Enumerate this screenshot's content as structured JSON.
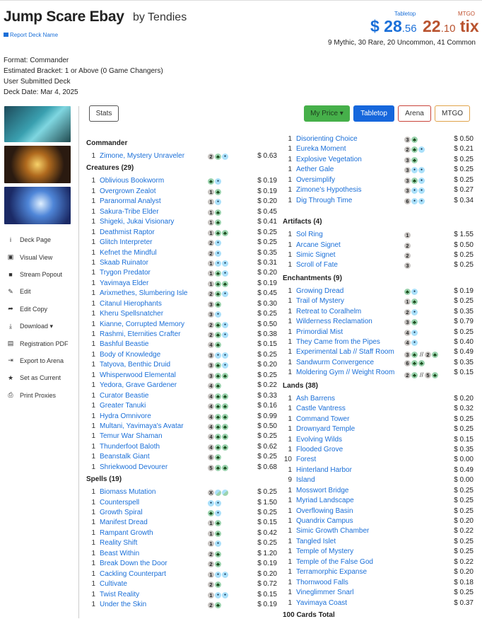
{
  "header": {
    "title": "Jump Scare Ebay",
    "author": "by Tendies",
    "report": "Report Deck Name",
    "tabletop_label": "Tabletop",
    "tabletop_price": "$ 28",
    "tabletop_cents": ".56",
    "mtgo_label": "MTGO",
    "mtgo_price": "22",
    "mtgo_cents": ".10",
    "mtgo_unit": " tix",
    "rarity": "9 Mythic, 30 Rare, 20 Uncommon, 41 Common"
  },
  "meta": {
    "format": "Format: Commander",
    "bracket": "Estimated Bracket: 1 or Above (0 Game Changers)",
    "source": "User Submitted Deck",
    "date": "Deck Date: Mar 4, 2025"
  },
  "sidebar": [
    {
      "icon": "info-icon",
      "glyph": "i",
      "label": "Deck Page"
    },
    {
      "icon": "image-icon",
      "glyph": "▣",
      "label": "Visual View"
    },
    {
      "icon": "video-icon",
      "glyph": "■",
      "label": "Stream Popout"
    },
    {
      "icon": "edit-icon",
      "glyph": "✎",
      "label": "Edit"
    },
    {
      "icon": "share-icon",
      "glyph": "➦",
      "label": "Edit Copy"
    },
    {
      "icon": "download-icon",
      "glyph": "⤓",
      "label": "Download ▾"
    },
    {
      "icon": "pdf-icon",
      "glyph": "▤",
      "label": "Registration PDF"
    },
    {
      "icon": "export-icon",
      "glyph": "⇥",
      "label": "Export to Arena"
    },
    {
      "icon": "star-icon",
      "glyph": "★",
      "label": "Set as Current"
    },
    {
      "icon": "print-icon",
      "glyph": "⎙",
      "label": "Print Proxies"
    }
  ],
  "toolbar": {
    "stats": "Stats",
    "my_price": "My Price ▾",
    "tabletop": "Tabletop",
    "arena": "Arena",
    "mtgo": "MTGO"
  },
  "colors": {
    "link": "#1a6fd8",
    "green": "#46b04a",
    "blue": "#1667dc",
    "mtgo": "#b9532f"
  },
  "columns": [
    [
      {
        "title": "Commander",
        "cards": [
          {
            "q": "1",
            "n": "Zimone, Mystery Unraveler",
            "m": [
              "2",
              "G",
              "U"
            ],
            "p": "$ 0.63"
          }
        ]
      },
      {
        "title": "Creatures (29)",
        "cards": [
          {
            "q": "1",
            "n": "Oblivious Bookworm",
            "m": [
              "G",
              "U"
            ],
            "p": "$ 0.19"
          },
          {
            "q": "1",
            "n": "Overgrown Zealot",
            "m": [
              "1",
              "G"
            ],
            "p": "$ 0.19"
          },
          {
            "q": "1",
            "n": "Paranormal Analyst",
            "m": [
              "1",
              "U"
            ],
            "p": "$ 0.20"
          },
          {
            "q": "1",
            "n": "Sakura-Tribe Elder",
            "m": [
              "1",
              "G"
            ],
            "p": "$ 0.45"
          },
          {
            "q": "1",
            "n": "Shigeki, Jukai Visionary",
            "m": [
              "1",
              "G"
            ],
            "p": "$ 0.41"
          },
          {
            "q": "1",
            "n": "Deathmist Raptor",
            "m": [
              "1",
              "G",
              "G"
            ],
            "p": "$ 0.25"
          },
          {
            "q": "1",
            "n": "Glitch Interpreter",
            "m": [
              "2",
              "U"
            ],
            "p": "$ 0.25"
          },
          {
            "q": "1",
            "n": "Kefnet the Mindful",
            "m": [
              "2",
              "U"
            ],
            "p": "$ 0.35"
          },
          {
            "q": "1",
            "n": "Skaab Ruinator",
            "m": [
              "1",
              "U",
              "U"
            ],
            "p": "$ 0.31"
          },
          {
            "q": "1",
            "n": "Trygon Predator",
            "m": [
              "1",
              "G",
              "U"
            ],
            "p": "$ 0.20"
          },
          {
            "q": "1",
            "n": "Yavimaya Elder",
            "m": [
              "1",
              "G",
              "G"
            ],
            "p": "$ 0.19"
          },
          {
            "q": "1",
            "n": "Arixmethes, Slumbering Isle",
            "m": [
              "2",
              "G",
              "U"
            ],
            "p": "$ 0.45"
          },
          {
            "q": "1",
            "n": "Citanul Hierophants",
            "m": [
              "3",
              "G"
            ],
            "p": "$ 0.30"
          },
          {
            "q": "1",
            "n": "Kheru Spellsnatcher",
            "m": [
              "3",
              "U"
            ],
            "p": "$ 0.25"
          },
          {
            "q": "1",
            "n": "Kianne, Corrupted Memory",
            "m": [
              "2",
              "G",
              "U"
            ],
            "p": "$ 0.50"
          },
          {
            "q": "1",
            "n": "Rashmi, Eternities Crafter",
            "m": [
              "2",
              "G",
              "U"
            ],
            "p": "$ 0.38"
          },
          {
            "q": "1",
            "n": "Bashful Beastie",
            "m": [
              "4",
              "G"
            ],
            "p": "$ 0.15"
          },
          {
            "q": "1",
            "n": "Body of Knowledge",
            "m": [
              "3",
              "U",
              "U"
            ],
            "p": "$ 0.25"
          },
          {
            "q": "1",
            "n": "Tatyova, Benthic Druid",
            "m": [
              "3",
              "G",
              "U"
            ],
            "p": "$ 0.20"
          },
          {
            "q": "1",
            "n": "Whisperwood Elemental",
            "m": [
              "3",
              "G",
              "G"
            ],
            "p": "$ 0.25"
          },
          {
            "q": "1",
            "n": "Yedora, Grave Gardener",
            "m": [
              "4",
              "G"
            ],
            "p": "$ 0.22"
          },
          {
            "q": "1",
            "n": "Curator Beastie",
            "m": [
              "4",
              "G",
              "G"
            ],
            "p": "$ 0.33"
          },
          {
            "q": "1",
            "n": "Greater Tanuki",
            "m": [
              "4",
              "G",
              "G"
            ],
            "p": "$ 0.16"
          },
          {
            "q": "1",
            "n": "Hydra Omnivore",
            "m": [
              "4",
              "G",
              "G"
            ],
            "p": "$ 0.99"
          },
          {
            "q": "1",
            "n": "Multani, Yavimaya's Avatar",
            "m": [
              "4",
              "G",
              "G"
            ],
            "p": "$ 0.50"
          },
          {
            "q": "1",
            "n": "Temur War Shaman",
            "m": [
              "4",
              "G",
              "G"
            ],
            "p": "$ 0.25"
          },
          {
            "q": "1",
            "n": "Thunderfoot Baloth",
            "m": [
              "4",
              "G",
              "G"
            ],
            "p": "$ 0.62"
          },
          {
            "q": "1",
            "n": "Beanstalk Giant",
            "m": [
              "6",
              "G"
            ],
            "p": "$ 0.25"
          },
          {
            "q": "1",
            "n": "Shriekwood Devourer",
            "m": [
              "5",
              "G",
              "G"
            ],
            "p": "$ 0.68"
          }
        ]
      },
      {
        "title": "Spells (19)",
        "cards": [
          {
            "q": "1",
            "n": "Biomass Mutation",
            "m": [
              "X",
              "H",
              "H"
            ],
            "p": "$ 0.25"
          },
          {
            "q": "1",
            "n": "Counterspell",
            "m": [
              "U",
              "U"
            ],
            "p": "$ 1.50"
          },
          {
            "q": "1",
            "n": "Growth Spiral",
            "m": [
              "G",
              "U"
            ],
            "p": "$ 0.25"
          },
          {
            "q": "1",
            "n": "Manifest Dread",
            "m": [
              "1",
              "G"
            ],
            "p": "$ 0.15"
          },
          {
            "q": "1",
            "n": "Rampant Growth",
            "m": [
              "1",
              "G"
            ],
            "p": "$ 0.42"
          },
          {
            "q": "1",
            "n": "Reality Shift",
            "m": [
              "1",
              "U"
            ],
            "p": "$ 0.25"
          },
          {
            "q": "1",
            "n": "Beast Within",
            "m": [
              "2",
              "G"
            ],
            "p": "$ 1.20"
          },
          {
            "q": "1",
            "n": "Break Down the Door",
            "m": [
              "2",
              "G"
            ],
            "p": "$ 0.19"
          },
          {
            "q": "1",
            "n": "Cackling Counterpart",
            "m": [
              "1",
              "U",
              "U"
            ],
            "p": "$ 0.20"
          },
          {
            "q": "1",
            "n": "Cultivate",
            "m": [
              "2",
              "G"
            ],
            "p": "$ 0.72"
          },
          {
            "q": "1",
            "n": "Twist Reality",
            "m": [
              "1",
              "U",
              "U"
            ],
            "p": "$ 0.15"
          },
          {
            "q": "1",
            "n": "Under the Skin",
            "m": [
              "2",
              "G"
            ],
            "p": "$ 0.19"
          }
        ]
      }
    ],
    [
      {
        "title": "",
        "cards": [
          {
            "q": "1",
            "n": "Disorienting Choice",
            "m": [
              "3",
              "G"
            ],
            "p": "$ 0.50"
          },
          {
            "q": "1",
            "n": "Eureka Moment",
            "m": [
              "2",
              "G",
              "U"
            ],
            "p": "$ 0.21"
          },
          {
            "q": "1",
            "n": "Explosive Vegetation",
            "m": [
              "3",
              "G"
            ],
            "p": "$ 0.25"
          },
          {
            "q": "1",
            "n": "Aether Gale",
            "m": [
              "3",
              "U",
              "U"
            ],
            "p": "$ 0.25"
          },
          {
            "q": "1",
            "n": "Oversimplify",
            "m": [
              "3",
              "G",
              "U"
            ],
            "p": "$ 0.25"
          },
          {
            "q": "1",
            "n": "Zimone's Hypothesis",
            "m": [
              "3",
              "U",
              "U"
            ],
            "p": "$ 0.27"
          },
          {
            "q": "1",
            "n": "Dig Through Time",
            "m": [
              "6",
              "U",
              "U"
            ],
            "p": "$ 0.34"
          }
        ]
      },
      {
        "title": "Artifacts (4)",
        "cards": [
          {
            "q": "1",
            "n": "Sol Ring",
            "m": [
              "1"
            ],
            "p": "$ 1.55"
          },
          {
            "q": "1",
            "n": "Arcane Signet",
            "m": [
              "2"
            ],
            "p": "$ 0.50"
          },
          {
            "q": "1",
            "n": "Simic Signet",
            "m": [
              "2"
            ],
            "p": "$ 0.25"
          },
          {
            "q": "1",
            "n": "Scroll of Fate",
            "m": [
              "3"
            ],
            "p": "$ 0.25"
          }
        ]
      },
      {
        "title": "Enchantments (9)",
        "cards": [
          {
            "q": "1",
            "n": "Growing Dread",
            "m": [
              "G",
              "U"
            ],
            "p": "$ 0.19"
          },
          {
            "q": "1",
            "n": "Trail of Mystery",
            "m": [
              "1",
              "G"
            ],
            "p": "$ 0.25"
          },
          {
            "q": "1",
            "n": "Retreat to Coralhelm",
            "m": [
              "2",
              "U"
            ],
            "p": "$ 0.35"
          },
          {
            "q": "1",
            "n": "Wilderness Reclamation",
            "m": [
              "3",
              "G"
            ],
            "p": "$ 0.79"
          },
          {
            "q": "1",
            "n": "Primordial Mist",
            "m": [
              "4",
              "U"
            ],
            "p": "$ 0.25"
          },
          {
            "q": "1",
            "n": "They Came from the Pipes",
            "m": [
              "4",
              "U"
            ],
            "p": "$ 0.40"
          },
          {
            "q": "1",
            "n": "Experimental Lab // Staff Room",
            "m": [
              "3",
              "G",
              "//",
              "2",
              "G"
            ],
            "p": "$ 0.49"
          },
          {
            "q": "1",
            "n": "Sandwurm Convergence",
            "m": [
              "6",
              "G",
              "G"
            ],
            "p": "$ 0.35"
          },
          {
            "q": "1",
            "n": "Moldering Gym // Weight Room",
            "m": [
              "2",
              "G",
              "//",
              "5",
              "G"
            ],
            "p": "$ 0.15"
          }
        ]
      },
      {
        "title": "Lands (38)",
        "cards": [
          {
            "q": "1",
            "n": "Ash Barrens",
            "m": [],
            "p": "$ 0.20"
          },
          {
            "q": "1",
            "n": "Castle Vantress",
            "m": [],
            "p": "$ 0.32"
          },
          {
            "q": "1",
            "n": "Command Tower",
            "m": [],
            "p": "$ 0.25"
          },
          {
            "q": "1",
            "n": "Drownyard Temple",
            "m": [],
            "p": "$ 0.25"
          },
          {
            "q": "1",
            "n": "Evolving Wilds",
            "m": [],
            "p": "$ 0.15"
          },
          {
            "q": "1",
            "n": "Flooded Grove",
            "m": [],
            "p": "$ 0.35"
          },
          {
            "q": "10",
            "n": "Forest",
            "m": [],
            "p": "$ 0.00"
          },
          {
            "q": "1",
            "n": "Hinterland Harbor",
            "m": [],
            "p": "$ 0.49"
          },
          {
            "q": "9",
            "n": "Island",
            "m": [],
            "p": "$ 0.00"
          },
          {
            "q": "1",
            "n": "Mosswort Bridge",
            "m": [],
            "p": "$ 0.25"
          },
          {
            "q": "1",
            "n": "Myriad Landscape",
            "m": [],
            "p": "$ 0.25"
          },
          {
            "q": "1",
            "n": "Overflowing Basin",
            "m": [],
            "p": "$ 0.25"
          },
          {
            "q": "1",
            "n": "Quandrix Campus",
            "m": [],
            "p": "$ 0.20"
          },
          {
            "q": "1",
            "n": "Simic Growth Chamber",
            "m": [],
            "p": "$ 0.22"
          },
          {
            "q": "1",
            "n": "Tangled Islet",
            "m": [],
            "p": "$ 0.25"
          },
          {
            "q": "1",
            "n": "Temple of Mystery",
            "m": [],
            "p": "$ 0.25"
          },
          {
            "q": "1",
            "n": "Temple of the False God",
            "m": [],
            "p": "$ 0.22"
          },
          {
            "q": "1",
            "n": "Terramorphic Expanse",
            "m": [],
            "p": "$ 0.20"
          },
          {
            "q": "1",
            "n": "Thornwood Falls",
            "m": [],
            "p": "$ 0.18"
          },
          {
            "q": "1",
            "n": "Vineglimmer Snarl",
            "m": [],
            "p": "$ 0.25"
          },
          {
            "q": "1",
            "n": "Yavimaya Coast",
            "m": [],
            "p": "$ 0.37"
          }
        ]
      }
    ]
  ],
  "total": "100 Cards Total"
}
